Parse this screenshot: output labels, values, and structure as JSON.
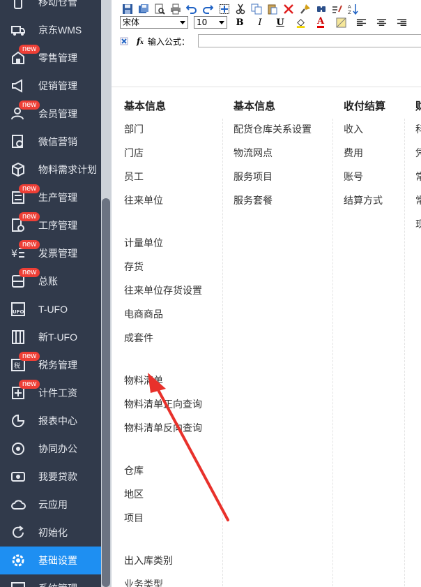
{
  "sidebar": {
    "items": [
      {
        "label": "移动仓管",
        "icon": "mobile-warehouse-icon",
        "badge": ""
      },
      {
        "label": "京东WMS",
        "icon": "truck-icon",
        "badge": ""
      },
      {
        "label": "零售管理",
        "icon": "store-icon",
        "badge": "new"
      },
      {
        "label": "促销管理",
        "icon": "megaphone-icon",
        "badge": ""
      },
      {
        "label": "会员管理",
        "icon": "member-icon",
        "badge": "new"
      },
      {
        "label": "微信营销",
        "icon": "wechat-marketing-icon",
        "badge": ""
      },
      {
        "label": "物料需求计划",
        "icon": "cube-icon",
        "badge": ""
      },
      {
        "label": "生产管理",
        "icon": "sliders-icon",
        "badge": "new"
      },
      {
        "label": "工序管理",
        "icon": "process-doc-icon",
        "badge": "new"
      },
      {
        "label": "发票管理",
        "icon": "invoice-icon",
        "badge": "new"
      },
      {
        "label": "总账",
        "icon": "ledger-icon",
        "badge": "new"
      },
      {
        "label": "T-UFO",
        "icon": "ufo-icon",
        "badge": ""
      },
      {
        "label": "新T-UFO",
        "icon": "new-ufo-icon",
        "badge": ""
      },
      {
        "label": "税务管理",
        "icon": "tax-icon",
        "badge": "new"
      },
      {
        "label": "计件工资",
        "icon": "piecework-icon",
        "badge": "new"
      },
      {
        "label": "报表中心",
        "icon": "pie-chart-icon",
        "badge": ""
      },
      {
        "label": "协同办公",
        "icon": "collaboration-icon",
        "badge": ""
      },
      {
        "label": "我要贷款",
        "icon": "money-icon",
        "badge": ""
      },
      {
        "label": "云应用",
        "icon": "cloud-icon",
        "badge": ""
      },
      {
        "label": "初始化",
        "icon": "refresh-icon",
        "badge": ""
      },
      {
        "label": "基础设置",
        "icon": "settings-gear-icon",
        "badge": ""
      },
      {
        "label": "系统管理",
        "icon": "system-icon",
        "badge": ""
      }
    ],
    "active_index": 20
  },
  "toolbar": {
    "font_name": "宋体",
    "font_size": "10",
    "bold": "B",
    "italic": "I",
    "underline": "U",
    "font_color": "A",
    "formula_label": "输入公式："
  },
  "columns": [
    {
      "title": "基本信息",
      "groups": [
        [
          "部门",
          "门店",
          "员工",
          "往来单位"
        ],
        [
          "计量单位",
          "存货",
          "往来单位存货设置",
          "电商商品",
          "成套件"
        ],
        [
          "物料清单",
          "物料清单正向查询",
          "物料清单反向查询"
        ],
        [
          "仓库",
          "地区",
          "项目"
        ],
        [
          "出入库类别",
          "业务类型"
        ]
      ]
    },
    {
      "title": "基本信息",
      "groups": [
        [
          "配货仓库关系设置",
          "物流网点",
          "服务项目",
          "服务套餐"
        ]
      ]
    },
    {
      "title": "收付结算",
      "groups": [
        [
          "收入",
          "费用",
          "账号",
          "结算方式"
        ]
      ]
    },
    {
      "title": "财",
      "groups": [
        [
          "科",
          "凭",
          "常",
          "常",
          "现"
        ]
      ]
    }
  ],
  "colors": {
    "sidebar_bg": "#313a4b",
    "active_bg": "#1e8ff2",
    "badge_bg": "#ee3f36",
    "arrow": "#e8312b"
  }
}
